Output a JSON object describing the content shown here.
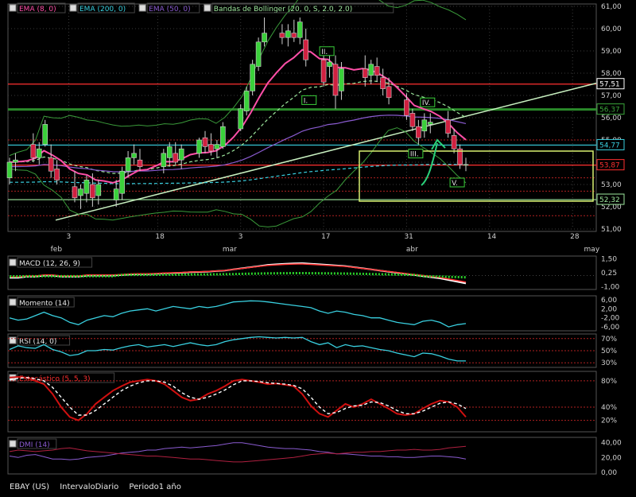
{
  "footer": {
    "symbol": "EBAY (US)",
    "interval": "IntervaloDiario",
    "period": "Periodo1 año"
  },
  "main_legend": [
    {
      "label": "EMA (8, 0)",
      "color": "#ff4fa8",
      "checked": true
    },
    {
      "label": "EMA (200, 0)",
      "color": "#39d0e0",
      "checked": true
    },
    {
      "label": "EMA (50, 0)",
      "color": "#8a5bd0",
      "checked": true
    },
    {
      "label": "Bandas de Bollinger (20, 0, S, 2.0, 2.0)",
      "color": "#9ee89e",
      "checked": true
    }
  ],
  "price_axis_ticks": [
    "61,00",
    "60,00",
    "59,00",
    "58,00",
    "57,00",
    "56,00",
    "55,00",
    "54,00",
    "53,00",
    "52,00",
    "51,00"
  ],
  "price_tags": [
    {
      "text": "57,51",
      "color": "#ffffff"
    },
    {
      "text": "56,37",
      "color": "#3aa63a"
    },
    {
      "text": "54,77",
      "color": "#39d0e0"
    },
    {
      "text": "53,87",
      "color": "#ff3030"
    },
    {
      "text": "52,32",
      "color": "#9ee89e"
    }
  ],
  "date_axis": {
    "day_labels": [
      "3",
      "18",
      "3",
      "17",
      "31",
      "14",
      "28"
    ],
    "month_labels": [
      "feb",
      "mar",
      "abr",
      "may"
    ]
  },
  "wave_labels": [
    "I.",
    "II.",
    "III.",
    "IV.",
    "V."
  ],
  "panels": [
    {
      "legend": "MACD (12, 26, 9)",
      "color": "#ffffff",
      "ticks": [
        "1,50",
        "0,25",
        "-1,00"
      ]
    },
    {
      "legend": "Momento (14)",
      "color": "#39d0e0",
      "ticks": [
        "6,00",
        "2,00",
        "-2,00",
        "-6,00"
      ]
    },
    {
      "legend": "RSI (14, 0)",
      "color": "#39d0e0",
      "ticks": [
        "70%",
        "50%",
        "30%"
      ]
    },
    {
      "legend": "Estocástico (5, 5, 3)",
      "color": "#ff3030",
      "ticks": [
        "80%",
        "40%",
        "20%"
      ]
    },
    {
      "legend": "DMI (14)",
      "color": "#8a5bd0",
      "ticks": [
        "40,00",
        "20,00",
        "0,00"
      ]
    }
  ],
  "chart_data": {
    "type": "candlestick",
    "symbol": "EBAY (US)",
    "interval": "daily",
    "y_range": [
      51,
      61
    ],
    "x_range": [
      "2008-01-24",
      "2008-05-02"
    ],
    "candles": [
      {
        "d": "2008-01-24",
        "o": 53.3,
        "h": 54.2,
        "l": 53.0,
        "c": 54.0
      },
      {
        "d": "2008-01-25",
        "o": 54.0,
        "h": 54.4,
        "l": 53.6,
        "c": 54.1
      },
      {
        "d": "2008-01-28",
        "o": 54.8,
        "h": 55.3,
        "l": 54.0,
        "c": 54.2
      },
      {
        "d": "2008-01-29",
        "o": 54.2,
        "h": 54.9,
        "l": 53.9,
        "c": 54.6
      },
      {
        "d": "2008-01-30",
        "o": 54.8,
        "h": 55.9,
        "l": 54.7,
        "c": 55.7
      },
      {
        "d": "2008-01-31",
        "o": 54.2,
        "h": 54.8,
        "l": 53.3,
        "c": 53.6
      },
      {
        "d": "2008-02-01",
        "o": 53.7,
        "h": 54.1,
        "l": 53.0,
        "c": 53.2
      },
      {
        "d": "2008-02-04",
        "o": 52.9,
        "h": 53.6,
        "l": 52.2,
        "c": 52.4
      },
      {
        "d": "2008-02-05",
        "o": 52.5,
        "h": 53.0,
        "l": 51.9,
        "c": 52.8
      },
      {
        "d": "2008-02-06",
        "o": 52.6,
        "h": 53.4,
        "l": 52.2,
        "c": 53.2
      },
      {
        "d": "2008-02-07",
        "o": 53.0,
        "h": 53.5,
        "l": 52.0,
        "c": 52.4
      },
      {
        "d": "2008-02-08",
        "o": 52.5,
        "h": 53.2,
        "l": 52.1,
        "c": 53.0
      },
      {
        "d": "2008-02-11",
        "o": 52.3,
        "h": 53.2,
        "l": 52.0,
        "c": 52.8
      },
      {
        "d": "2008-02-12",
        "o": 52.6,
        "h": 53.8,
        "l": 52.3,
        "c": 53.6
      },
      {
        "d": "2008-02-13",
        "o": 53.6,
        "h": 54.5,
        "l": 53.3,
        "c": 54.2
      },
      {
        "d": "2008-02-14",
        "o": 54.2,
        "h": 54.8,
        "l": 53.9,
        "c": 54.4
      },
      {
        "d": "2008-02-15",
        "o": 54.1,
        "h": 54.6,
        "l": 53.6,
        "c": 53.8
      },
      {
        "d": "2008-02-19",
        "o": 53.8,
        "h": 54.6,
        "l": 53.5,
        "c": 54.4
      },
      {
        "d": "2008-02-20",
        "o": 54.2,
        "h": 54.9,
        "l": 53.8,
        "c": 54.7
      },
      {
        "d": "2008-02-21",
        "o": 54.4,
        "h": 54.9,
        "l": 53.9,
        "c": 54.0
      },
      {
        "d": "2008-02-22",
        "o": 54.1,
        "h": 54.8,
        "l": 53.7,
        "c": 54.6
      },
      {
        "d": "2008-02-25",
        "o": 54.4,
        "h": 55.1,
        "l": 54.2,
        "c": 55.0
      },
      {
        "d": "2008-02-26",
        "o": 55.1,
        "h": 55.4,
        "l": 54.4,
        "c": 54.7
      },
      {
        "d": "2008-02-27",
        "o": 54.8,
        "h": 55.3,
        "l": 54.3,
        "c": 54.5
      },
      {
        "d": "2008-02-28",
        "o": 54.6,
        "h": 55.0,
        "l": 54.2,
        "c": 54.8
      },
      {
        "d": "2008-02-29",
        "o": 54.7,
        "h": 55.8,
        "l": 54.6,
        "c": 55.6
      },
      {
        "d": "2008-03-03",
        "o": 55.5,
        "h": 56.6,
        "l": 55.4,
        "c": 56.4
      },
      {
        "d": "2008-03-04",
        "o": 56.3,
        "h": 57.4,
        "l": 56.1,
        "c": 57.2
      },
      {
        "d": "2008-03-05",
        "o": 57.2,
        "h": 58.6,
        "l": 57.0,
        "c": 58.4
      },
      {
        "d": "2008-03-06",
        "o": 58.3,
        "h": 59.6,
        "l": 58.1,
        "c": 59.4
      },
      {
        "d": "2008-03-07",
        "o": 59.4,
        "h": 60.5,
        "l": 59.2,
        "c": 59.8
      },
      {
        "d": "2008-03-10",
        "o": 59.8,
        "h": 60.2,
        "l": 59.3,
        "c": 59.6
      },
      {
        "d": "2008-03-11",
        "o": 59.6,
        "h": 60.2,
        "l": 59.2,
        "c": 59.9
      },
      {
        "d": "2008-03-12",
        "o": 59.8,
        "h": 60.4,
        "l": 59.4,
        "c": 59.6
      },
      {
        "d": "2008-03-13",
        "o": 59.6,
        "h": 60.5,
        "l": 59.3,
        "c": 60.3
      },
      {
        "d": "2008-03-14",
        "o": 59.5,
        "h": 60.0,
        "l": 58.3,
        "c": 58.6
      },
      {
        "d": "2008-03-17",
        "o": 58.6,
        "h": 59.0,
        "l": 57.4,
        "c": 57.6
      },
      {
        "d": "2008-03-18",
        "o": 58.3,
        "h": 59.2,
        "l": 57.8,
        "c": 58.5
      },
      {
        "d": "2008-03-19",
        "o": 58.4,
        "h": 58.8,
        "l": 56.4,
        "c": 57.0
      },
      {
        "d": "2008-03-20",
        "o": 57.2,
        "h": 58.5,
        "l": 56.8,
        "c": 58.2
      },
      {
        "d": "2008-03-24",
        "o": 58.2,
        "h": 58.8,
        "l": 57.4,
        "c": 57.8
      },
      {
        "d": "2008-03-25",
        "o": 57.9,
        "h": 58.6,
        "l": 57.5,
        "c": 58.4
      },
      {
        "d": "2008-03-26",
        "o": 58.3,
        "h": 58.7,
        "l": 57.6,
        "c": 57.9
      },
      {
        "d": "2008-03-27",
        "o": 57.8,
        "h": 58.2,
        "l": 57.0,
        "c": 57.3
      },
      {
        "d": "2008-03-28",
        "o": 57.4,
        "h": 57.8,
        "l": 56.6,
        "c": 56.9
      },
      {
        "d": "2008-03-31",
        "o": 56.8,
        "h": 57.1,
        "l": 55.9,
        "c": 56.1
      },
      {
        "d": "2008-04-01",
        "o": 56.2,
        "h": 56.4,
        "l": 55.4,
        "c": 55.6
      },
      {
        "d": "2008-04-02",
        "o": 55.6,
        "h": 55.9,
        "l": 54.8,
        "c": 55.1
      },
      {
        "d": "2008-04-03",
        "o": 55.4,
        "h": 56.2,
        "l": 55.1,
        "c": 55.9
      },
      {
        "d": "2008-04-04",
        "o": 55.7,
        "h": 56.2,
        "l": 55.3,
        "c": 55.8
      },
      {
        "d": "2008-04-07",
        "o": 55.9,
        "h": 56.3,
        "l": 55.1,
        "c": 55.3
      },
      {
        "d": "2008-04-08",
        "o": 55.2,
        "h": 55.5,
        "l": 54.4,
        "c": 54.6
      },
      {
        "d": "2008-04-09",
        "o": 54.6,
        "h": 54.8,
        "l": 53.7,
        "c": 53.9
      },
      {
        "d": "2008-04-10",
        "o": 53.9,
        "h": 54.2,
        "l": 53.6,
        "c": 53.9
      }
    ],
    "lines": [
      {
        "name": "EMA (8, 0)",
        "color": "#ff4fa8"
      },
      {
        "name": "EMA (200, 0)",
        "color": "#39d0e0"
      },
      {
        "name": "EMA (50, 0)",
        "color": "#8a5bd0"
      },
      {
        "name": "Bandas de Bollinger (20, 0, S, 2.0, 2.0)",
        "color": "#9ee89e"
      }
    ],
    "horizontal_levels": [
      {
        "value": 57.51,
        "color": "#ff3030"
      },
      {
        "value": 56.37,
        "color": "#2a8a2a"
      },
      {
        "value": 54.77,
        "color": "#39d0e0"
      },
      {
        "value": 53.87,
        "color": "#ff3030"
      },
      {
        "value": 52.32,
        "color": "#9ee89e"
      }
    ],
    "macd": [
      -0.2,
      -0.2,
      -0.1,
      -0.1,
      0.0,
      0.0,
      -0.1,
      -0.1,
      -0.1,
      0.0,
      0.0,
      0.0,
      0.0,
      0.05,
      0.1,
      0.12,
      0.12,
      0.15,
      0.2,
      0.22,
      0.25,
      0.3,
      0.32,
      0.35,
      0.4,
      0.45,
      0.55,
      0.65,
      0.75,
      0.85,
      0.95,
      1.0,
      1.05,
      1.08,
      1.1,
      1.05,
      1.0,
      0.95,
      0.9,
      0.85,
      0.75,
      0.65,
      0.55,
      0.45,
      0.35,
      0.25,
      0.15,
      0.05,
      -0.05,
      -0.15,
      -0.25,
      -0.4,
      -0.55,
      -0.7
    ],
    "momentum": [
      -2,
      -3,
      -2.5,
      -1,
      0.5,
      -1,
      -2,
      -4,
      -5,
      -3,
      -2,
      -1,
      -1.5,
      0,
      1,
      1.5,
      2,
      1,
      2,
      3,
      2.5,
      2,
      3,
      2.5,
      3,
      4,
      5,
      5.2,
      5.5,
      5.4,
      5,
      4.5,
      4,
      3.5,
      3,
      2.5,
      1,
      0,
      1,
      0.5,
      -0.5,
      -1,
      -2,
      -2,
      -3,
      -4,
      -4.5,
      -5,
      -3.5,
      -3,
      -4,
      -6,
      -5,
      -4.5
    ],
    "rsi": [
      52,
      58,
      55,
      54,
      60,
      52,
      48,
      42,
      44,
      50,
      50,
      52,
      51,
      55,
      58,
      60,
      56,
      58,
      60,
      57,
      60,
      63,
      60,
      58,
      60,
      65,
      68,
      70,
      72,
      73,
      72,
      71,
      72,
      71,
      72,
      65,
      60,
      63,
      55,
      60,
      57,
      58,
      55,
      52,
      50,
      46,
      43,
      40,
      46,
      45,
      41,
      36,
      33,
      33
    ],
    "stochastic_k": [
      85,
      86,
      85,
      80,
      75,
      60,
      40,
      25,
      20,
      30,
      45,
      55,
      65,
      72,
      78,
      80,
      82,
      80,
      75,
      65,
      55,
      50,
      52,
      60,
      65,
      72,
      80,
      82,
      80,
      78,
      75,
      76,
      74,
      72,
      60,
      42,
      30,
      25,
      35,
      45,
      40,
      45,
      52,
      45,
      38,
      30,
      28,
      30,
      38,
      45,
      50,
      48,
      40,
      25
    ],
    "stochastic_d": [
      82,
      84,
      85,
      83,
      80,
      70,
      55,
      40,
      28,
      28,
      35,
      45,
      55,
      65,
      72,
      77,
      80,
      80,
      78,
      72,
      62,
      55,
      52,
      55,
      60,
      66,
      74,
      80,
      80,
      79,
      77,
      76,
      75,
      73,
      68,
      55,
      40,
      30,
      32,
      38,
      42,
      43,
      48,
      47,
      42,
      35,
      30,
      30,
      34,
      40,
      46,
      48,
      45,
      38
    ],
    "dmi_plus": [
      22,
      20,
      23,
      24,
      21,
      18,
      18,
      17,
      18,
      20,
      21,
      22,
      24,
      26,
      27,
      28,
      30,
      30,
      32,
      33,
      34,
      33,
      34,
      35,
      36,
      38,
      40,
      40,
      38,
      36,
      34,
      33,
      32,
      32,
      31,
      30,
      28,
      27,
      25,
      25,
      24,
      23,
      22,
      22,
      21,
      21,
      20,
      20,
      21,
      22,
      22,
      21,
      20,
      18
    ],
    "dmi_minus": [
      28,
      30,
      29,
      28,
      29,
      30,
      32,
      33,
      31,
      29,
      28,
      27,
      26,
      25,
      24,
      23,
      22,
      22,
      21,
      20,
      19,
      18,
      18,
      17,
      16,
      15,
      14,
      14,
      15,
      16,
      17,
      18,
      19,
      20,
      22,
      24,
      25,
      26,
      25,
      26,
      27,
      27,
      28,
      28,
      29,
      30,
      30,
      31,
      30,
      30,
      31,
      33,
      34,
      35
    ]
  }
}
